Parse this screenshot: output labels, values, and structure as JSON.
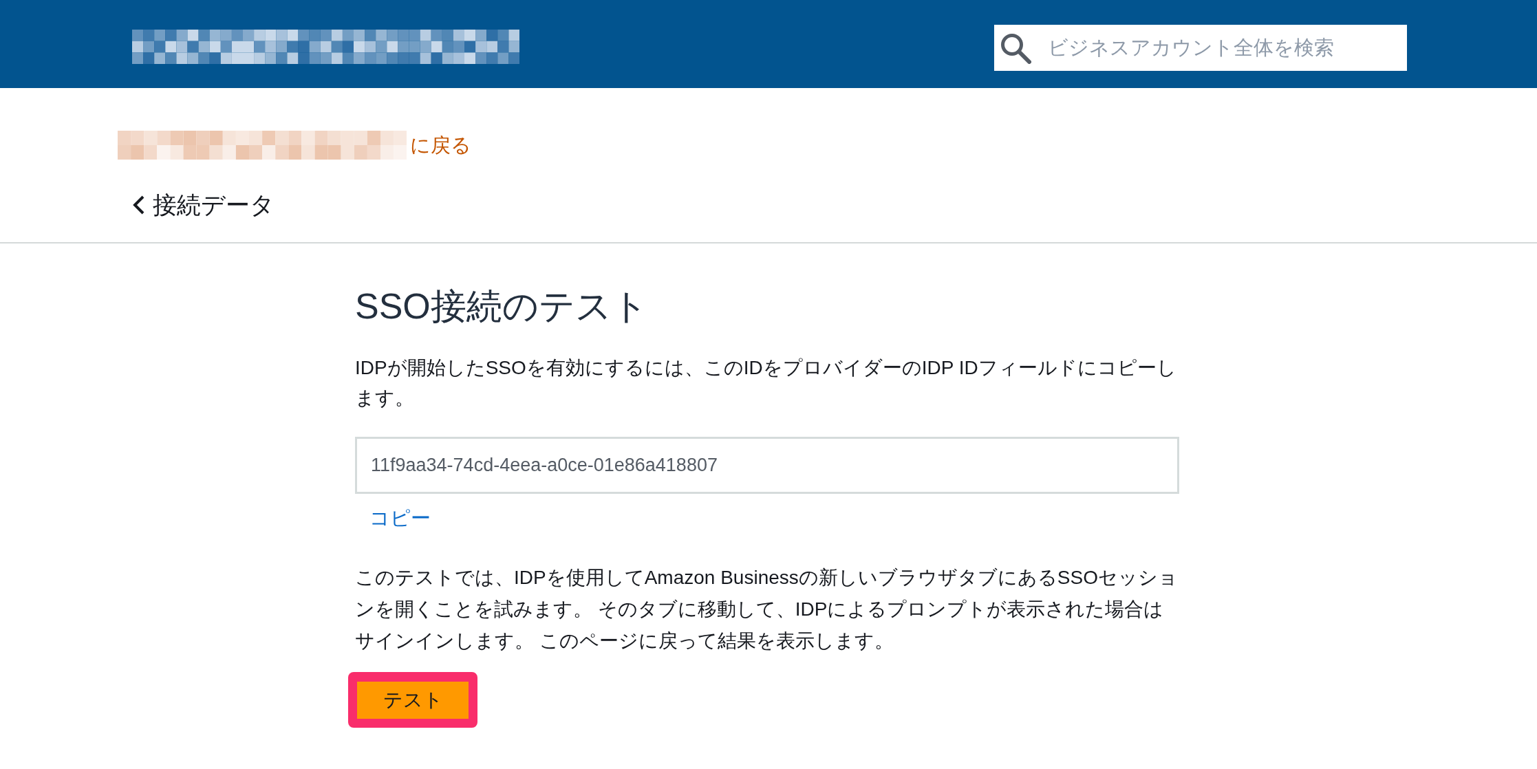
{
  "header": {
    "search": {
      "placeholder": "ビジネスアカウント全体を検索"
    }
  },
  "return_link": {
    "text": "に戻る"
  },
  "breadcrumb": {
    "text": "接続データ"
  },
  "content": {
    "title": "SSO接続のテスト",
    "description": "IDPが開始したSSOを有効にするには、このIDをプロバイダーのIDP IDフィールドにコピーします。",
    "id_field": {
      "value": "11f9aa34-74cd-4eea-a0ce-01e86a418807"
    },
    "copy_link": "コピー",
    "test_description": "このテストでは、IDPを使用してAmazon Businessの新しいブラウザタブにあるSSOセッションを開くことを試みます。 そのタブに移動して、IDPによるプロンプトが表示された場合はサインインします。 このページに戻って結果を表示します。",
    "test_button": {
      "label": "テスト",
      "highlighted": true
    }
  }
}
